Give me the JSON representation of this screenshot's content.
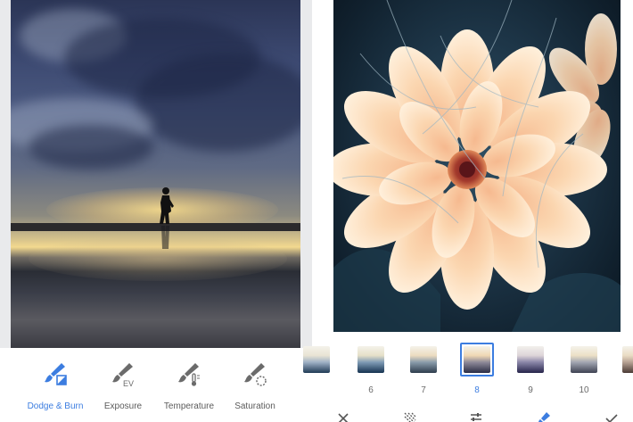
{
  "left_screen": {
    "tools": [
      {
        "label": "Dodge & Burn",
        "icon": "dodge-burn-brush-icon",
        "active": true
      },
      {
        "label": "Exposure",
        "icon": "exposure-brush-icon",
        "badge": "EV",
        "active": false
      },
      {
        "label": "Temperature",
        "icon": "temperature-brush-icon",
        "active": false
      },
      {
        "label": "Saturation",
        "icon": "saturation-brush-icon",
        "active": false
      }
    ]
  },
  "right_screen": {
    "filters": [
      {
        "label": "6"
      },
      {
        "label": "7"
      },
      {
        "label": "8",
        "selected": true
      },
      {
        "label": "9"
      },
      {
        "label": "10"
      }
    ],
    "bottom_icons": [
      "close-icon",
      "texture-icon",
      "tune-icon",
      "brush-icon",
      "check-icon"
    ]
  },
  "colors": {
    "accent": "#3c7de0",
    "label_gray": "#5b5b5b",
    "toolbar_bg": "#ffffff"
  }
}
